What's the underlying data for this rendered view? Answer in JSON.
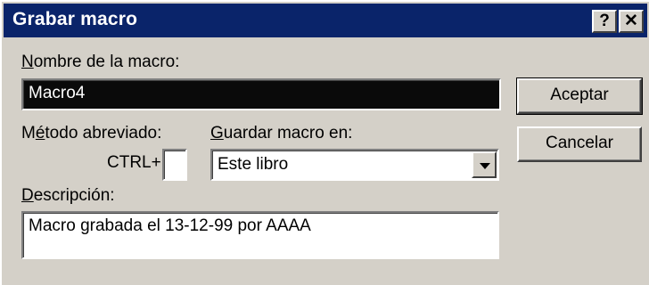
{
  "window": {
    "title": "Grabar macro",
    "help_button": "?",
    "close_button": "✕"
  },
  "form": {
    "name_label_acc": "N",
    "name_label_rest": "ombre de la macro:",
    "name_value": "Macro4",
    "shortcut_label_pre": "M",
    "shortcut_label_acc": "é",
    "shortcut_label_rest": "todo abreviado:",
    "ctrl_prefix": "CTRL+",
    "ctrl_value": "",
    "store_label_acc": "G",
    "store_label_rest": "uardar macro en:",
    "store_selected": "Este libro",
    "desc_label_acc": "D",
    "desc_label_rest": "escripción:",
    "desc_value": "Macro grabada el 13-12-99 por AAAA"
  },
  "buttons": {
    "accept": "Aceptar",
    "cancel": "Cancelar"
  }
}
